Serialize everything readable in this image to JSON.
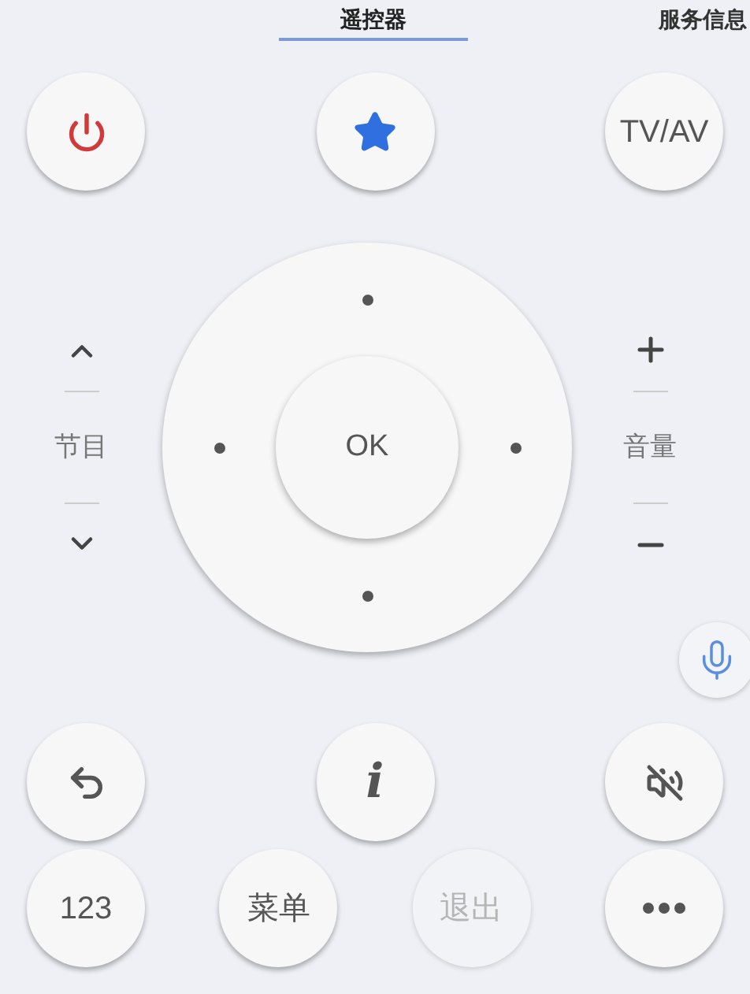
{
  "tabs": [
    {
      "label": "遥控器",
      "selected": true
    },
    {
      "label": "服务信息",
      "selected": false
    }
  ],
  "top_buttons": [
    {
      "kind": "power"
    },
    {
      "kind": "favorite"
    },
    {
      "kind": "text",
      "label": "TV/AV"
    }
  ],
  "channel": {
    "label": "节目"
  },
  "volume": {
    "label": "音量"
  },
  "dpad": {
    "ok": "OK"
  },
  "bottom_rows": [
    [
      {
        "kind": "back",
        "disabled": false
      },
      {
        "kind": "info",
        "label": "i",
        "disabled": false
      },
      {
        "kind": "mute",
        "disabled": false
      }
    ],
    [
      {
        "kind": "text",
        "label": "123",
        "disabled": false
      },
      {
        "kind": "text",
        "label": "菜单",
        "disabled": false
      },
      {
        "kind": "text",
        "label": "退出",
        "disabled": true
      },
      {
        "kind": "more",
        "disabled": false
      }
    ]
  ]
}
